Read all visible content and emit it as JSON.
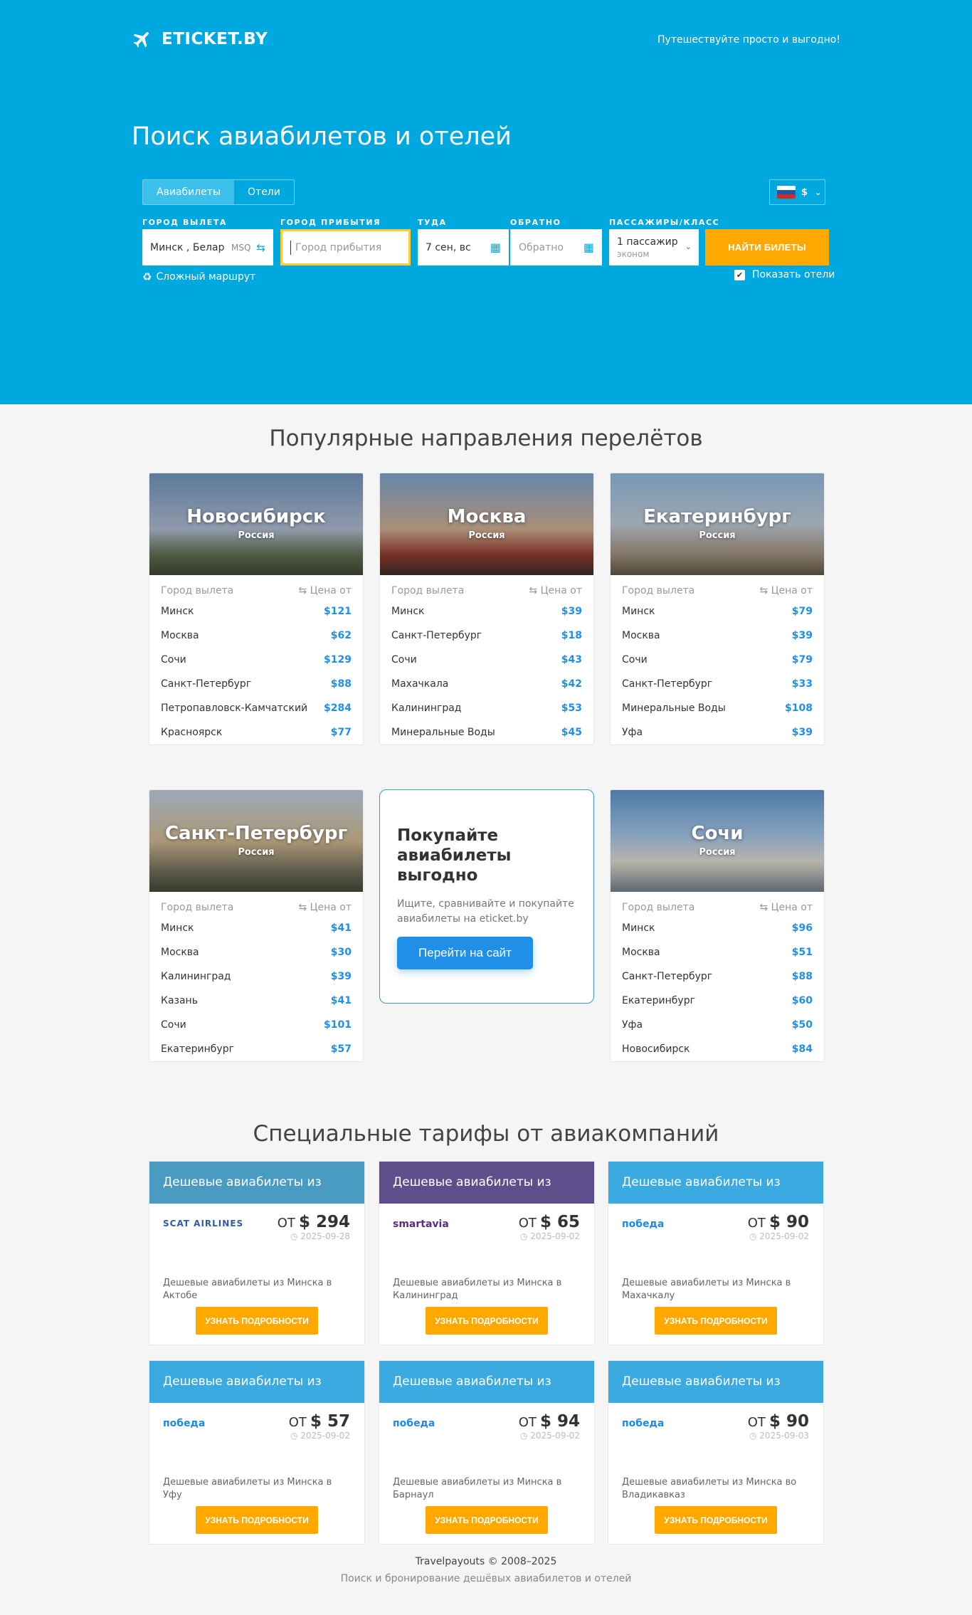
{
  "brand": {
    "name": "ETICKET.BY",
    "tagline": "Путешествуйте просто и выгодно!"
  },
  "hero": {
    "title": "Поиск авиабилетов и отелей"
  },
  "search": {
    "tabs": [
      {
        "label": "Авиабилеты",
        "active": true
      },
      {
        "label": "Отели",
        "active": false
      }
    ],
    "currency": "$",
    "labels": {
      "origin": "Город вылета",
      "destination": "Город прибытия",
      "depart": "Туда",
      "return": "Обратно",
      "passengers": "Пассажиры/класс"
    },
    "origin_value": "Минск , Беларусь",
    "origin_code": "MSQ",
    "destination_placeholder": "Город прибытия",
    "depart_value": "7 сен, вс",
    "return_placeholder": "Обратно",
    "passengers_value": "1 пассажир",
    "class_value": "эконом",
    "submit_label": "Найти билеты",
    "complex_route_label": "Сложный маршрут",
    "show_hotels_label": "Показать отели",
    "show_hotels_checked": true
  },
  "popular": {
    "title": "Популярные направления перелётов",
    "col_origin": "Город вылета",
    "col_price": "Цена от",
    "cards": [
      {
        "city": "Новосибирск",
        "country": "Россия",
        "rows": [
          [
            "Минск",
            "$121"
          ],
          [
            "Москва",
            "$62"
          ],
          [
            "Сочи",
            "$129"
          ],
          [
            "Санкт-Петербург",
            "$88"
          ],
          [
            "Петропавловск-Камчатский",
            "$284"
          ],
          [
            "Красноярск",
            "$77"
          ]
        ]
      },
      {
        "city": "Москва",
        "country": "Россия",
        "rows": [
          [
            "Минск",
            "$39"
          ],
          [
            "Санкт-Петербург",
            "$18"
          ],
          [
            "Сочи",
            "$43"
          ],
          [
            "Махачкала",
            "$42"
          ],
          [
            "Калининград",
            "$53"
          ],
          [
            "Минеральные Воды",
            "$45"
          ]
        ]
      },
      {
        "city": "Екатеринбург",
        "country": "Россия",
        "rows": [
          [
            "Минск",
            "$79"
          ],
          [
            "Москва",
            "$39"
          ],
          [
            "Сочи",
            "$79"
          ],
          [
            "Санкт-Петербург",
            "$33"
          ],
          [
            "Минеральные Воды",
            "$108"
          ],
          [
            "Уфа",
            "$39"
          ]
        ]
      },
      {
        "city": "Санкт-Петербург",
        "country": "Россия",
        "rows": [
          [
            "Минск",
            "$41"
          ],
          [
            "Москва",
            "$30"
          ],
          [
            "Калининград",
            "$39"
          ],
          [
            "Казань",
            "$41"
          ],
          [
            "Сочи",
            "$101"
          ],
          [
            "Екатеринбург",
            "$57"
          ]
        ]
      },
      {
        "city": "Сочи",
        "country": "Россия",
        "rows": [
          [
            "Минск",
            "$96"
          ],
          [
            "Москва",
            "$51"
          ],
          [
            "Санкт-Петербург",
            "$88"
          ],
          [
            "Екатеринбург",
            "$60"
          ],
          [
            "Уфа",
            "$50"
          ],
          [
            "Новосибирск",
            "$84"
          ]
        ]
      }
    ],
    "promo": {
      "title": "Покупайте авиабилеты выгодно",
      "text": "Ищите, сравнивайте и покупайте авиабилеты на eticket.by",
      "button": "Перейти на сайт"
    }
  },
  "offers": {
    "title": "Специальные тарифы от авиакомпаний",
    "from_label": "ОТ",
    "button_label": "Узнать подробности",
    "items": [
      {
        "header": "Дешевые авиабилеты из Минска",
        "airline": "SCAT AIRLINES",
        "price": "$ 294",
        "date": "2025-09-28",
        "desc": "Дешевые авиабилеты из Минска в Актобе",
        "color": "#4a9bc2"
      },
      {
        "header": "Дешевые авиабилеты из Минска",
        "airline": "smartavia",
        "price": "$ 65",
        "date": "2025-09-02",
        "desc": "Дешевые авиабилеты из Минска в Калининград",
        "color": "#5e4e8c"
      },
      {
        "header": "Дешевые авиабилеты из Минска",
        "airline": "победа",
        "price": "$ 90",
        "date": "2025-09-02",
        "desc": "Дешевые авиабилеты из Минска в Махачкалу",
        "color": "#3aaae0"
      },
      {
        "header": "Дешевые авиабилеты из Минска",
        "airline": "победа",
        "price": "$ 57",
        "date": "2025-09-02",
        "desc": "Дешевые авиабилеты из Минска в Уфу",
        "color": "#3aaae0"
      },
      {
        "header": "Дешевые авиабилеты из Минска",
        "airline": "победа",
        "price": "$ 94",
        "date": "2025-09-02",
        "desc": "Дешевые авиабилеты из Минска в Барнаул",
        "color": "#3aaae0"
      },
      {
        "header": "Дешевые авиабилеты из Минска",
        "airline": "победа",
        "price": "$ 90",
        "date": "2025-09-03",
        "desc": "Дешевые авиабилеты из Минска во Владикавказ",
        "color": "#3aaae0"
      }
    ]
  },
  "footer": {
    "copyright": "Travelpayouts © 2008–2025",
    "subtitle": "Поиск и бронирование дешёвых авиабилетов и отелей"
  },
  "colors": {
    "primary": "#00a8e0",
    "accent": "#ffa800",
    "link": "#1f8fe8"
  }
}
